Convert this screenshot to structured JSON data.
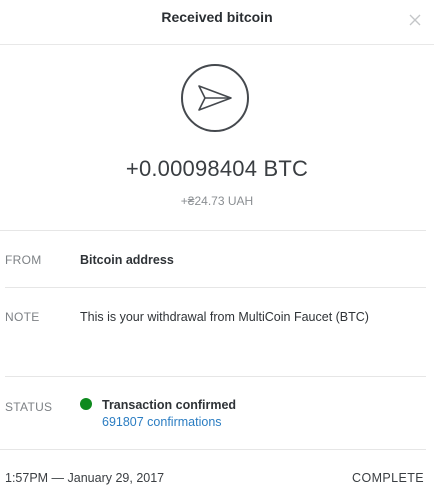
{
  "header": {
    "title": "Received bitcoin",
    "close_icon": "close-icon"
  },
  "transaction": {
    "direction_icon": "send-arrow-icon",
    "amount": "+0.00098404 BTC",
    "fiat_amount": "+₴24.73 UAH"
  },
  "details": {
    "from": {
      "label": "FROM",
      "value": "Bitcoin address"
    },
    "note": {
      "label": "NOTE",
      "value": "This is your withdrawal from MultiCoin Faucet (BTC)"
    },
    "status": {
      "label": "STATUS",
      "value": "Transaction confirmed",
      "confirmations": "691807 confirmations",
      "color": "#0e8a1e"
    }
  },
  "footer": {
    "timestamp": "1:57PM — January 29, 2017",
    "state": "COMPLETE"
  },
  "colors": {
    "link": "#2b7dc2",
    "confirmed": "#0e8a1e"
  }
}
